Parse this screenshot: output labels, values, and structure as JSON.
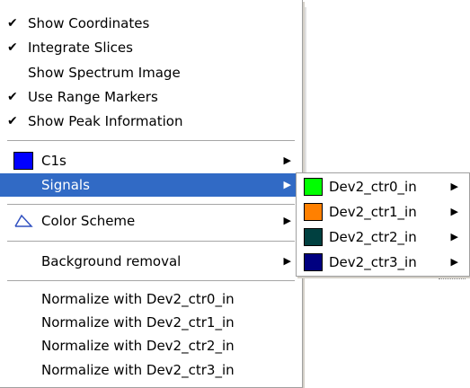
{
  "colors": {
    "highlight": "#316ac5",
    "c1s_swatch": "#0000ff",
    "ctr0": "#00ff00",
    "ctr1": "#ff8000",
    "ctr2": "#004040",
    "ctr3": "#000080"
  },
  "menu": {
    "show_coordinates": "Show Coordinates",
    "integrate_slices": "Integrate Slices",
    "show_spectrum_image": "Show Spectrum Image",
    "use_range_markers": "Use Range Markers",
    "show_peak_information": "Show Peak Information",
    "c1s": "C1s",
    "signals": "Signals",
    "color_scheme": "Color Scheme",
    "background_removal": "Background removal",
    "normalize_0": "Normalize with Dev2_ctr0_in",
    "normalize_1": "Normalize with Dev2_ctr1_in",
    "normalize_2": "Normalize with Dev2_ctr2_in",
    "normalize_3": "Normalize with Dev2_ctr3_in",
    "check_glyph": "✔",
    "submenu_arrow": "▶"
  },
  "submenu": {
    "items": [
      "Dev2_ctr0_in",
      "Dev2_ctr1_in",
      "Dev2_ctr2_in",
      "Dev2_ctr3_in"
    ]
  }
}
